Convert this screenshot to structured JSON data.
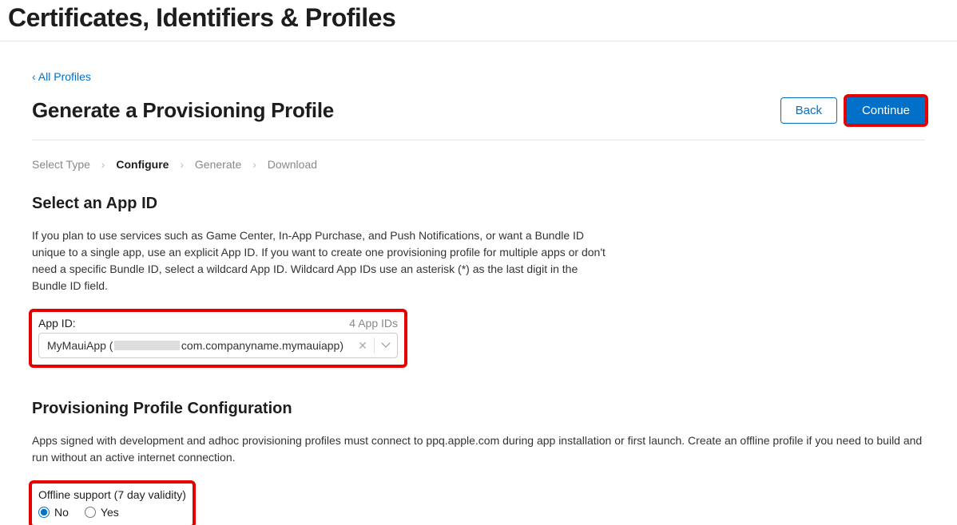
{
  "header": {
    "page_title": "Certificates, Identifiers & Profiles",
    "backlink": "‹ All Profiles",
    "subheading": "Generate a Provisioning Profile",
    "back_btn": "Back",
    "continue_btn": "Continue"
  },
  "breadcrumbs": {
    "step1": "Select Type",
    "step2": "Configure",
    "step3": "Generate",
    "step4": "Download"
  },
  "appid_section": {
    "title": "Select an App ID",
    "body": "If you plan to use services such as Game Center, In-App Purchase, and Push Notifications, or want a Bundle ID unique to a single app, use an explicit App ID. If you want to create one provisioning profile for multiple apps or don't need a specific Bundle ID, select a wildcard App ID. Wildcard App IDs use an asterisk (*) as the last digit in the Bundle ID field.",
    "label": "App ID:",
    "count": "4 App IDs",
    "value_prefix": "MyMauiApp (",
    "value_suffix": "com.companyname.mymauiapp)"
  },
  "config_section": {
    "title": "Provisioning Profile Configuration",
    "body": "Apps signed with development and adhoc provisioning profiles must connect to ppq.apple.com during app installation or first launch. Create an offline profile if you need to build and run without an active internet connection.",
    "radio_label": "Offline support (7 day validity)",
    "no_label": "No",
    "yes_label": "Yes"
  }
}
